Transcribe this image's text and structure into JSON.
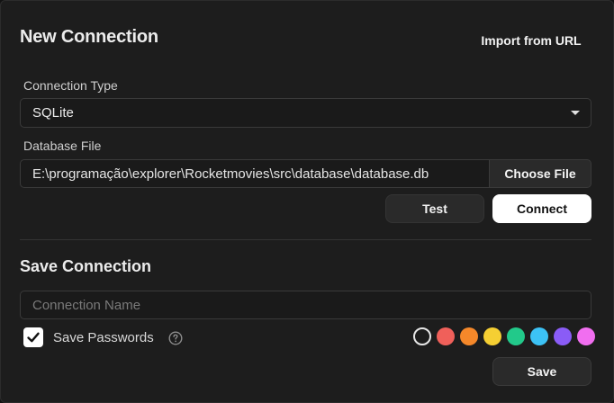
{
  "dialog": {
    "title": "New Connection",
    "import_label": "Import from URL"
  },
  "connection_type": {
    "label": "Connection Type",
    "selected": "SQLite"
  },
  "database_file": {
    "label": "Database File",
    "value": "E:\\programação\\explorer\\Rocketmovies\\src\\database\\database.db",
    "choose_label": "Choose File"
  },
  "actions": {
    "test_label": "Test",
    "connect_label": "Connect"
  },
  "save_section": {
    "title": "Save Connection",
    "name_placeholder": "Connection Name",
    "save_passwords_label": "Save Passwords",
    "save_passwords_checked": true,
    "save_label": "Save"
  },
  "colors": [
    {
      "name": "none",
      "hex": "transparent",
      "selected": true
    },
    {
      "name": "red",
      "hex": "#f0605a"
    },
    {
      "name": "orange",
      "hex": "#f5882a"
    },
    {
      "name": "yellow",
      "hex": "#f5cf33"
    },
    {
      "name": "green",
      "hex": "#22c98a"
    },
    {
      "name": "sky",
      "hex": "#3cc2f5"
    },
    {
      "name": "purple",
      "hex": "#8a5cf6"
    },
    {
      "name": "pink",
      "hex": "#f16ef0"
    }
  ]
}
